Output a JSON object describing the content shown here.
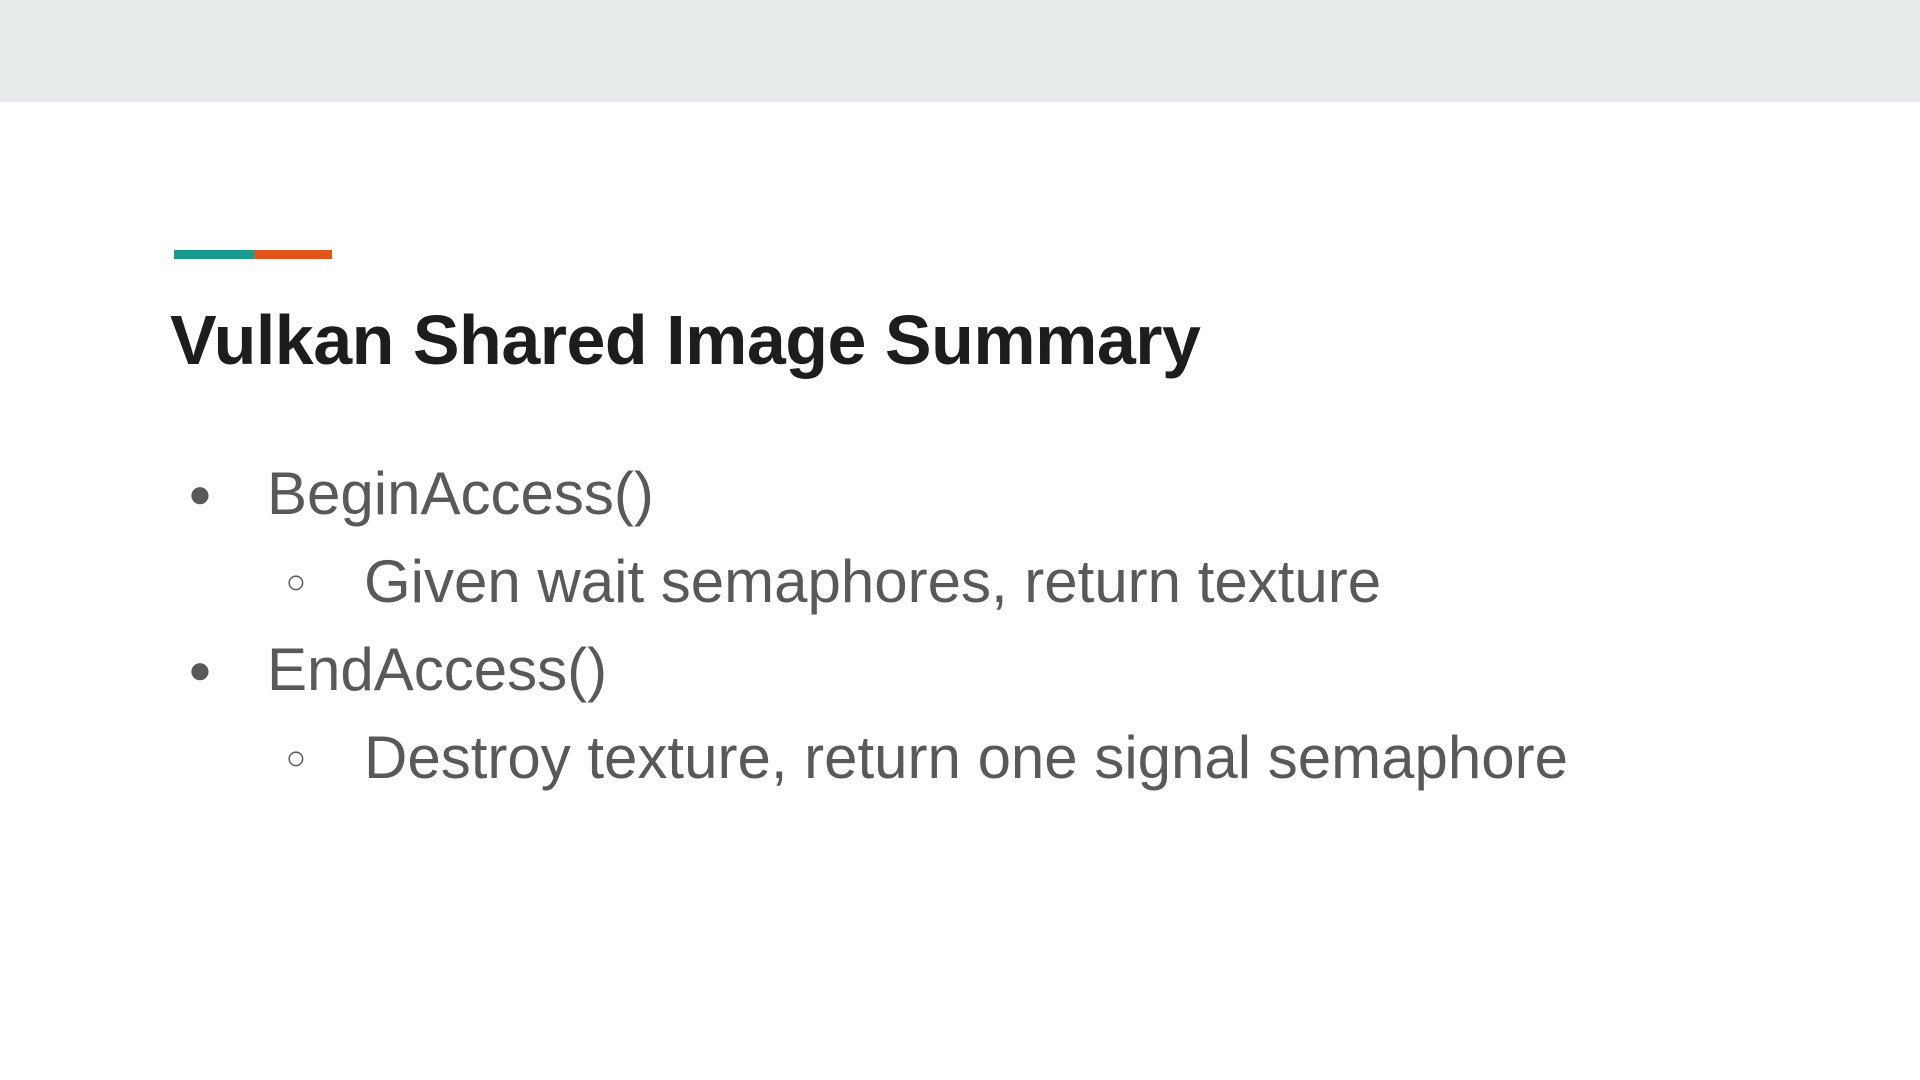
{
  "slide": {
    "title": "Vulkan Shared Image Summary",
    "accent_colors": [
      "#1a9b8f",
      "#e0551c"
    ],
    "background_band_color": "#e8ebec"
  },
  "bullets": [
    {
      "level": 1,
      "marker": "●",
      "text": "BeginAccess()"
    },
    {
      "level": 2,
      "marker": "○",
      "text": "Given wait semaphores, return texture"
    },
    {
      "level": 1,
      "marker": "●",
      "text": "EndAccess()"
    },
    {
      "level": 2,
      "marker": "○",
      "text": "Destroy texture, return one signal semaphore"
    }
  ]
}
